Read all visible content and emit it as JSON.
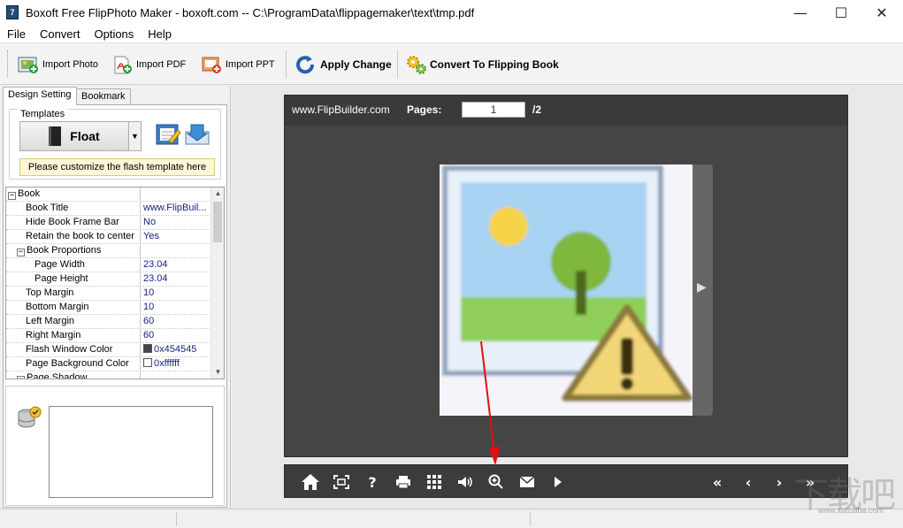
{
  "window": {
    "title": "Boxoft Free FlipPhoto Maker - boxoft.com -- C:\\ProgramData\\flippagemaker\\text\\tmp.pdf",
    "controls": {
      "minimize": "—",
      "maximize": "☐",
      "close": "✕"
    }
  },
  "menu": [
    "File",
    "Convert",
    "Options",
    "Help"
  ],
  "toolbar": {
    "import_photo": "Import Photo",
    "import_pdf": "Import PDF",
    "import_ppt": "Import PPT",
    "apply_change": "Apply Change",
    "convert": "Convert To Flipping Book"
  },
  "tabs": {
    "design": "Design Setting",
    "bookmark": "Bookmark"
  },
  "templates": {
    "label": "Templates",
    "selected": "Float",
    "note": "Please customize the flash template here"
  },
  "properties": [
    {
      "name": "Book",
      "value": "",
      "level": 0,
      "section": true
    },
    {
      "name": "Book Title",
      "value": "www.FlipBuil...",
      "level": 1
    },
    {
      "name": "Hide Book Frame Bar",
      "value": "No",
      "level": 1
    },
    {
      "name": "Retain the book to center",
      "value": "Yes",
      "level": 1
    },
    {
      "name": "Book Proportions",
      "value": "",
      "level": 1,
      "section": true
    },
    {
      "name": "Page Width",
      "value": "23.04",
      "level": 2
    },
    {
      "name": "Page Height",
      "value": "23.04",
      "level": 2
    },
    {
      "name": "Top Margin",
      "value": "10",
      "level": 1
    },
    {
      "name": "Bottom Margin",
      "value": "10",
      "level": 1
    },
    {
      "name": "Left Margin",
      "value": "60",
      "level": 1
    },
    {
      "name": "Right Margin",
      "value": "60",
      "level": 1
    },
    {
      "name": "Flash Window Color",
      "value": "0x454545",
      "level": 1,
      "swatch": "#454545"
    },
    {
      "name": "Page Background Color",
      "value": "0xffffff",
      "level": 1,
      "swatch": "#ffffff"
    },
    {
      "name": "Page Shadow",
      "value": "",
      "level": 1,
      "section": true
    }
  ],
  "viewer": {
    "site": "www.FlipBuilder.com",
    "pages_label": "Pages:",
    "current_page": "1",
    "total_pages": "/2",
    "frame_color": "#454545"
  },
  "controls": [
    "home-icon",
    "fit-screen-icon",
    "help-icon",
    "print-icon",
    "thumbnails-icon",
    "sound-icon",
    "zoom-in-icon",
    "email-icon",
    "autoplay-icon",
    "first-page-icon",
    "previous-page-icon",
    "next-page-icon",
    "last-page-icon"
  ],
  "watermark": {
    "text": "下载吧",
    "url": "www.xiazaiba.com"
  }
}
